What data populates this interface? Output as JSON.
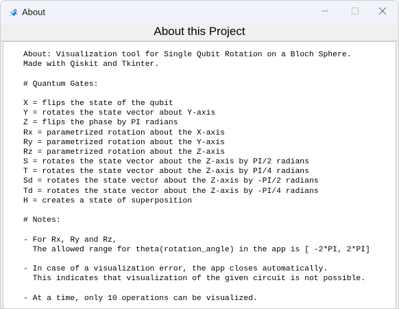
{
  "window": {
    "title": "About",
    "icon": "tkinter-feather-icon",
    "controls": {
      "minimize_icon": "minimize-icon",
      "maximize_icon": "maximize-icon",
      "close_icon": "close-icon"
    }
  },
  "heading": "About this Project",
  "about_lines": [
    "About: Visualization tool for Single Qubit Rotation on a Bloch Sphere.",
    "Made with Qiskit and Tkinter.",
    "",
    "# Quantum Gates:",
    "",
    "X = flips the state of the qubit",
    "Y = rotates the state vector about Y-axis",
    "Z = flips the phase by PI radians",
    "Rx = parametrized rotation about the X-axis",
    "Ry = parametrized rotation about the Y-axis",
    "Rz = parametrized rotation about the Z-axis",
    "S = rotates the state vector about the Z-axis by PI/2 radians",
    "T = rotates the state vector about the Z-axis by PI/4 radians",
    "Sd = rotates the state vector about the Z-axis by -PI/2 radians",
    "Td = rotates the state vector about the Z-axis by -PI/4 radians",
    "H = creates a state of superposition",
    "",
    "# Notes:",
    "",
    "- For Rx, Ry and Rz,",
    "  The allowed range for theta(rotation_angle) in the app is [ -2*PI, 2*PI]",
    "",
    "- In case of a visualization error, the app closes automatically.",
    "  This indicates that visualization of the given circuit is not possible.",
    "",
    "- At a time, only 10 operations can be visualized."
  ],
  "colors": {
    "titlebar": "#f0f3f9",
    "window_bg": "#f0f0f0",
    "content_bg": "#ffffff",
    "icon_blue": "#2a7fd4"
  }
}
